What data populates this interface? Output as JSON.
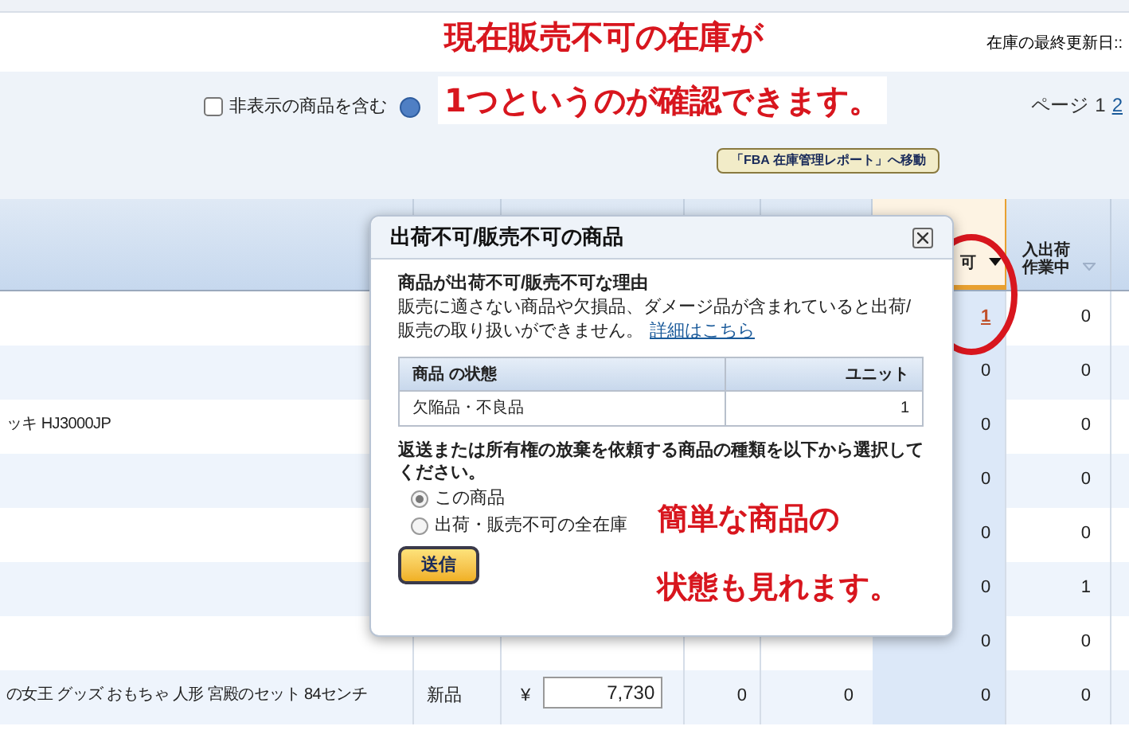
{
  "header": {
    "last_updated_label": "在庫の最終更新日::"
  },
  "filters": {
    "include_hidden": {
      "label": "非表示の商品を含む",
      "checked": false
    },
    "pagination": {
      "label": "ページ",
      "pages": [
        {
          "label": "1",
          "selected": true
        },
        {
          "label": "2",
          "selected": false
        }
      ]
    },
    "report_button": "「FBA 在庫管理レポート」へ移動"
  },
  "table": {
    "columns": [
      {},
      {},
      {},
      {},
      {},
      {
        "label": "可",
        "sorted": true
      },
      {
        "label": "入出荷作業中",
        "sorted": false
      },
      {}
    ],
    "rows": [
      {
        "unsellable": "1",
        "unsellable_link": true,
        "inbound": "0"
      },
      {
        "unsellable": "0",
        "unsellable_link": false,
        "inbound": "0"
      },
      {
        "product": "ッキ HJ3000JP",
        "unsellable": "0",
        "unsellable_link": false,
        "inbound": "0"
      },
      {
        "unsellable": "0",
        "unsellable_link": false,
        "inbound": "0"
      },
      {
        "unsellable": "0",
        "unsellable_link": false,
        "inbound": "0"
      },
      {
        "unsellable": "0",
        "unsellable_link": false,
        "inbound": "1"
      },
      {
        "unsellable": "0",
        "unsellable_link": false,
        "inbound": "0"
      },
      {
        "product": "の女王 グッズ おもちゃ 人形 宮殿のセット 84センチ",
        "condition": "新品",
        "currency": "¥",
        "price": "7,730",
        "col_4": "0",
        "col_5": "0",
        "unsellable": "0",
        "unsellable_link": false,
        "inbound": "0"
      }
    ]
  },
  "popup": {
    "title": "出荷不可/販売不可の商品",
    "reason_heading": "商品が出荷不可/販売不可な理由",
    "reason_text": "販売に適さない商品や欠損品、ダメージ品が含まれていると出荷/販売の取り扱いができません。",
    "details_link": "詳細はこちら",
    "status_table": {
      "columns": [
        "商品 の状態",
        "ユニット"
      ],
      "rows": [
        [
          "欠陥品・不良品",
          "1"
        ]
      ]
    },
    "prompt": "返送または所有権の放棄を依頼する商品の種類を以下から選択してください。",
    "options": [
      {
        "label": "この商品",
        "selected": true
      },
      {
        "label": "出荷・販売不可の全在庫",
        "selected": false
      }
    ],
    "submit": "送信"
  },
  "annotations": [
    {
      "lines": [
        "現在販売不可の在庫が",
        "1つというのが確認できます。"
      ]
    },
    {
      "lines": [
        "簡単な商品の",
        "状態も見れます。"
      ]
    }
  ]
}
